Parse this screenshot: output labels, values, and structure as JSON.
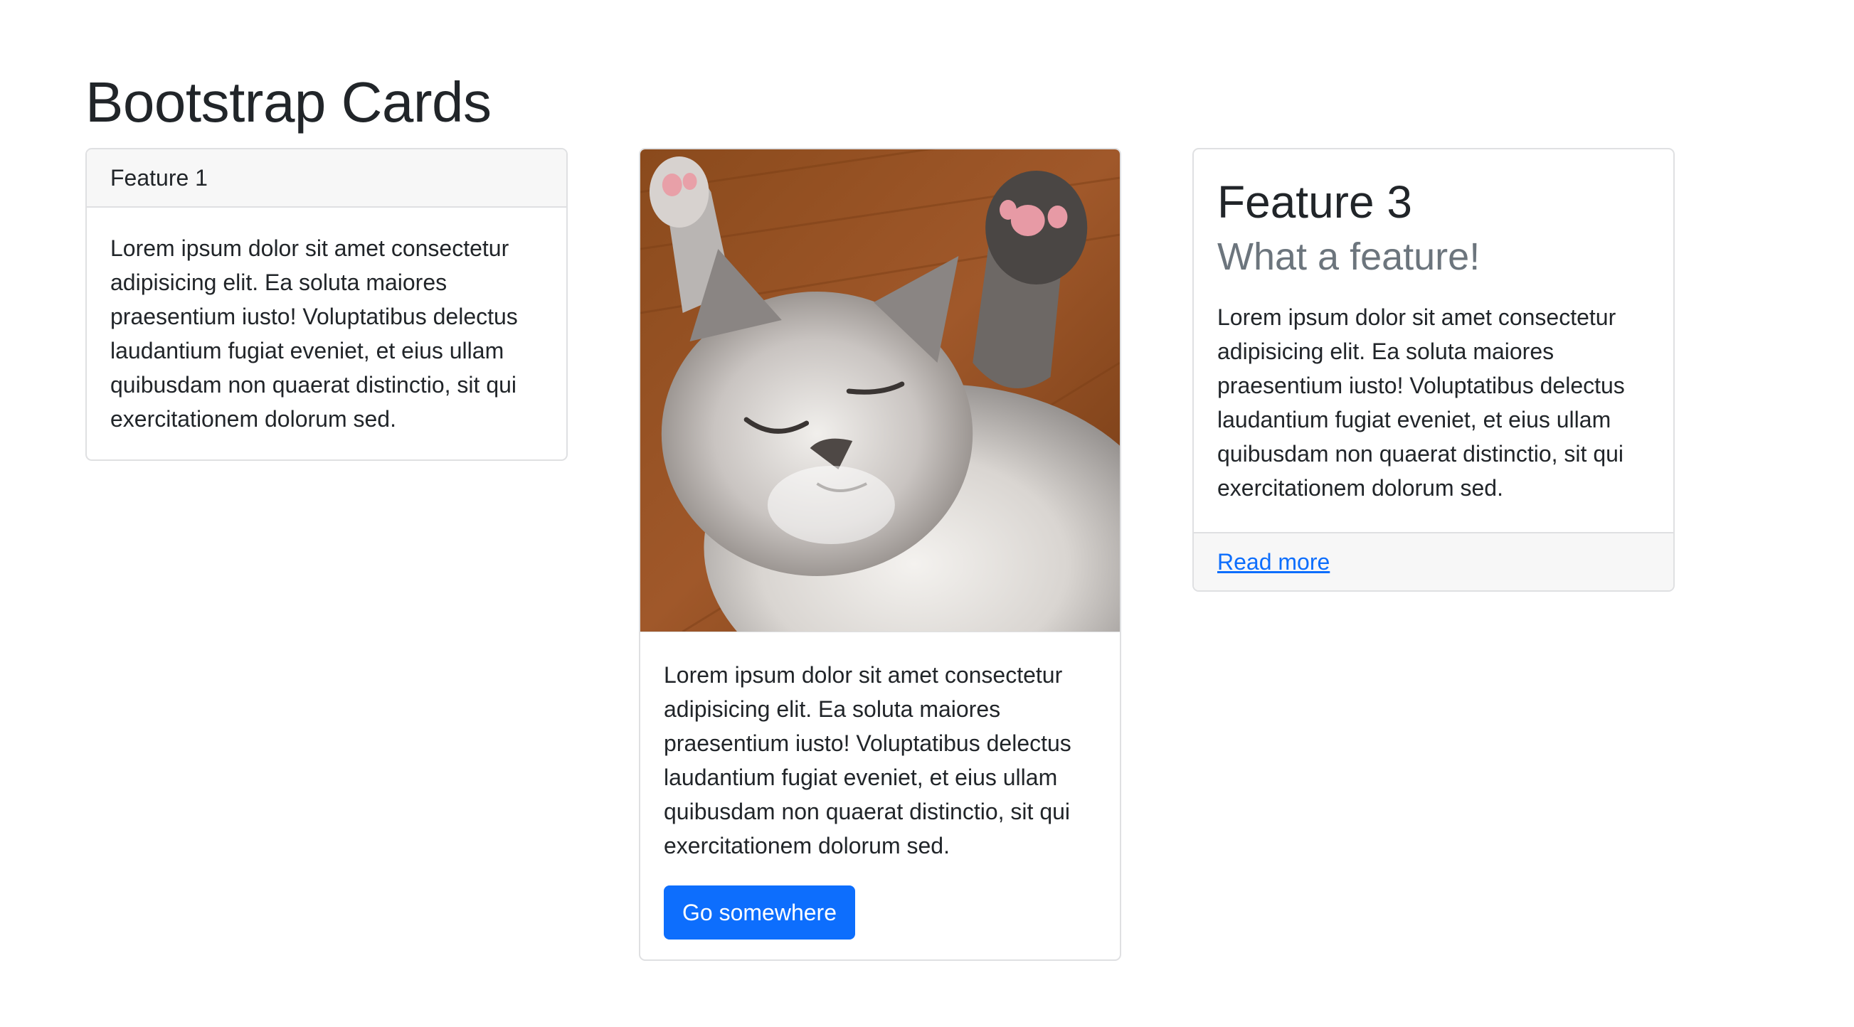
{
  "page": {
    "title": "Bootstrap Cards"
  },
  "cards": [
    {
      "header": "Feature 1",
      "text": "Lorem ipsum dolor sit amet consectetur adipisicing elit. Ea soluta maiores praesentium iusto! Voluptatibus delectus laudantium fugiat eveniet, et eius ullam quibusdam non quaerat distinctio, sit qui exercitationem dolorum sed."
    },
    {
      "image": "sleeping-kitten-photo",
      "text": "Lorem ipsum dolor sit amet consectetur adipisicing elit. Ea soluta maiores praesentium iusto! Voluptatibus delectus laudantium fugiat eveniet, et eius ullam quibusdam non quaerat distinctio, sit qui exercitationem dolorum sed.",
      "button_label": "Go somewhere"
    },
    {
      "title": "Feature 3",
      "subtitle": "What a feature!",
      "text": "Lorem ipsum dolor sit amet consectetur adipisicing elit. Ea soluta maiores praesentium iusto! Voluptatibus delectus laudantium fugiat eveniet, et eius ullam quibusdam non quaerat distinctio, sit qui exercitationem dolorum sed.",
      "footer_link": "Read more"
    }
  ],
  "colors": {
    "primary": "#0d6efd",
    "muted": "#6c757d",
    "card_border": "#dfe0e2",
    "card_cap_bg": "#f7f7f7",
    "text": "#212529"
  }
}
